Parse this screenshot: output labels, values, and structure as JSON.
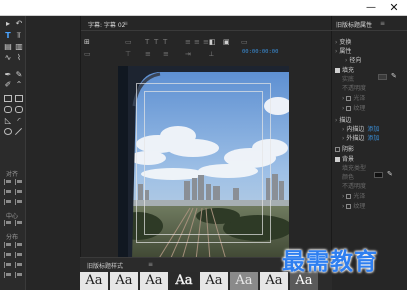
{
  "window": {
    "minimize_glyph": "—",
    "close_glyph": "✕"
  },
  "editor": {
    "tab_label": "字幕: 字幕 02",
    "tab_menu": "≡",
    "timecode": "00:00:00:00"
  },
  "tools": [
    "select-tool",
    "rotate-tool",
    "type-tool",
    "vertical-type-tool",
    "area-type-tool",
    "vertical-area-type-tool",
    "path-type-tool",
    "vertical-path-type-tool",
    "pen-tool",
    "delete-anchor-tool",
    "add-anchor-tool",
    "convert-anchor-tool",
    "rectangle-tool",
    "clipped-corner-tool",
    "rounded-rectangle-tool",
    "rounded-corner-tool",
    "wedge-tool",
    "arc-tool",
    "ellipse-tool",
    "line-tool"
  ],
  "left_sections": {
    "align": "对齐",
    "center": "中心",
    "distribute": "分布"
  },
  "styles": {
    "title": "旧版标题样式",
    "menu": "≡",
    "swatches": [
      "Aa",
      "Aa",
      "Aa",
      "Aa",
      "Aa",
      "Aa",
      "Aa",
      "Aa"
    ]
  },
  "properties": {
    "title": "旧版标题属性",
    "menu": "≡",
    "transform": "变换",
    "attributes": "属性",
    "fill_type": "径向",
    "fill": "填充",
    "fill_kind": "实底",
    "opacity": "不透明度",
    "sheen": "光泽",
    "texture": "纹理",
    "stroke": "描边",
    "inner_stroke": "内描边",
    "outer_stroke": "外描边",
    "add": "添加",
    "shadow": "阴影",
    "background": "背景",
    "bg_fill_type": "填充类型",
    "bg_color": "颜色",
    "bg_opacity": "不透明度",
    "bg_sheen": "光泽",
    "bg_texture": "纹理"
  },
  "colors": {
    "accent": "#3a8fd9",
    "panel_bg": "#262626",
    "background_chip": "#111111"
  },
  "watermark": "最需教育"
}
